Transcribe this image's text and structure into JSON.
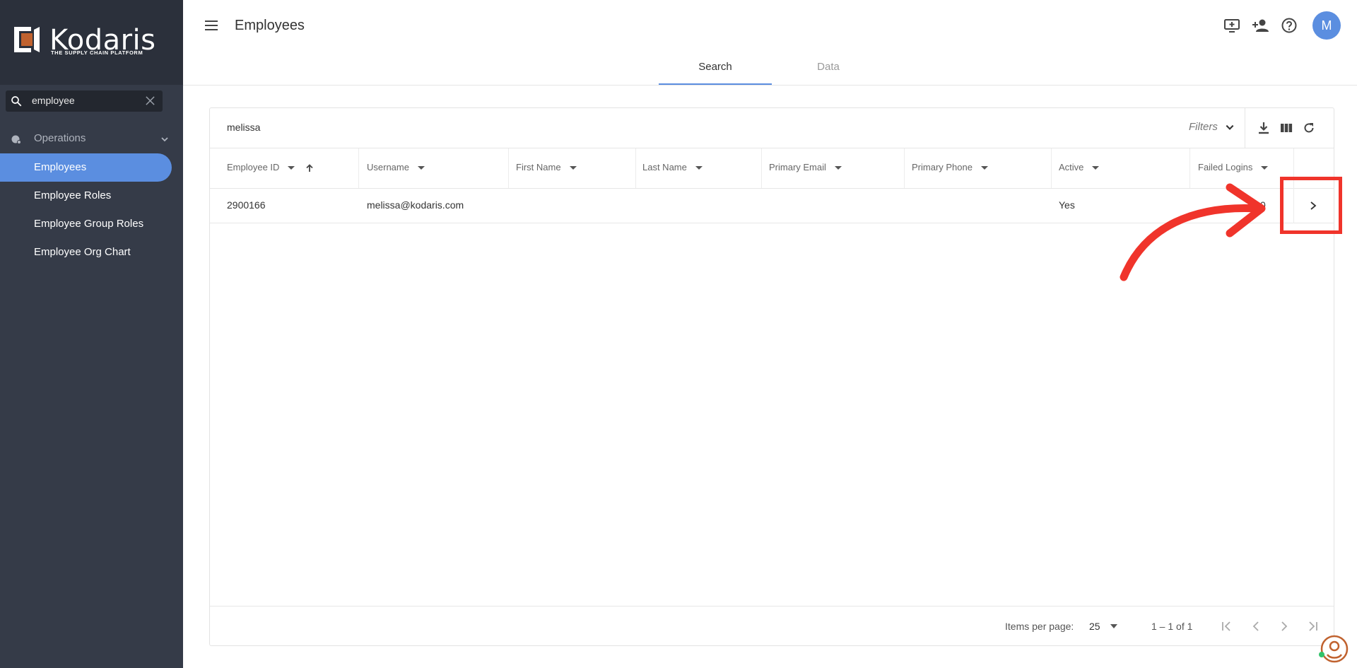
{
  "brand": {
    "name": "Kodaris",
    "tagline": "THE SUPPLY CHAIN PLATFORM",
    "accent": "#5b8ee0",
    "logo_orange": "#c0622f"
  },
  "sidebar": {
    "search_value": "employee",
    "group_label": "Operations",
    "items": [
      {
        "label": "Employees",
        "active": true
      },
      {
        "label": "Employee Roles",
        "active": false
      },
      {
        "label": "Employee Group Roles",
        "active": false
      },
      {
        "label": "Employee Org Chart",
        "active": false
      }
    ]
  },
  "header": {
    "title": "Employees",
    "avatar_initial": "M",
    "icons": [
      "add-to-screen-icon",
      "person-add-icon",
      "help-icon"
    ],
    "tabs": [
      {
        "label": "Search",
        "active": true
      },
      {
        "label": "Data",
        "active": false
      }
    ]
  },
  "toolbar": {
    "search_value": "melissa",
    "filters_label": "Filters",
    "icons": [
      "download-icon",
      "columns-icon",
      "refresh-icon"
    ]
  },
  "table": {
    "columns": [
      {
        "label": "Employee ID",
        "sorted": "asc"
      },
      {
        "label": "Username"
      },
      {
        "label": "First Name"
      },
      {
        "label": "Last Name"
      },
      {
        "label": "Primary Email"
      },
      {
        "label": "Primary Phone"
      },
      {
        "label": "Active"
      },
      {
        "label": "Failed Logins"
      }
    ],
    "rows": [
      {
        "employee_id": "2900166",
        "username": "melissa@kodaris.com",
        "first_name": "",
        "last_name": "",
        "primary_email": "",
        "primary_phone": "",
        "active": "Yes",
        "failed_logins": "0"
      }
    ]
  },
  "pagination": {
    "items_per_page_label": "Items per page:",
    "items_per_page": "25",
    "range_text": "1 – 1 of 1"
  },
  "annotation": {
    "color": "#f0342b"
  }
}
